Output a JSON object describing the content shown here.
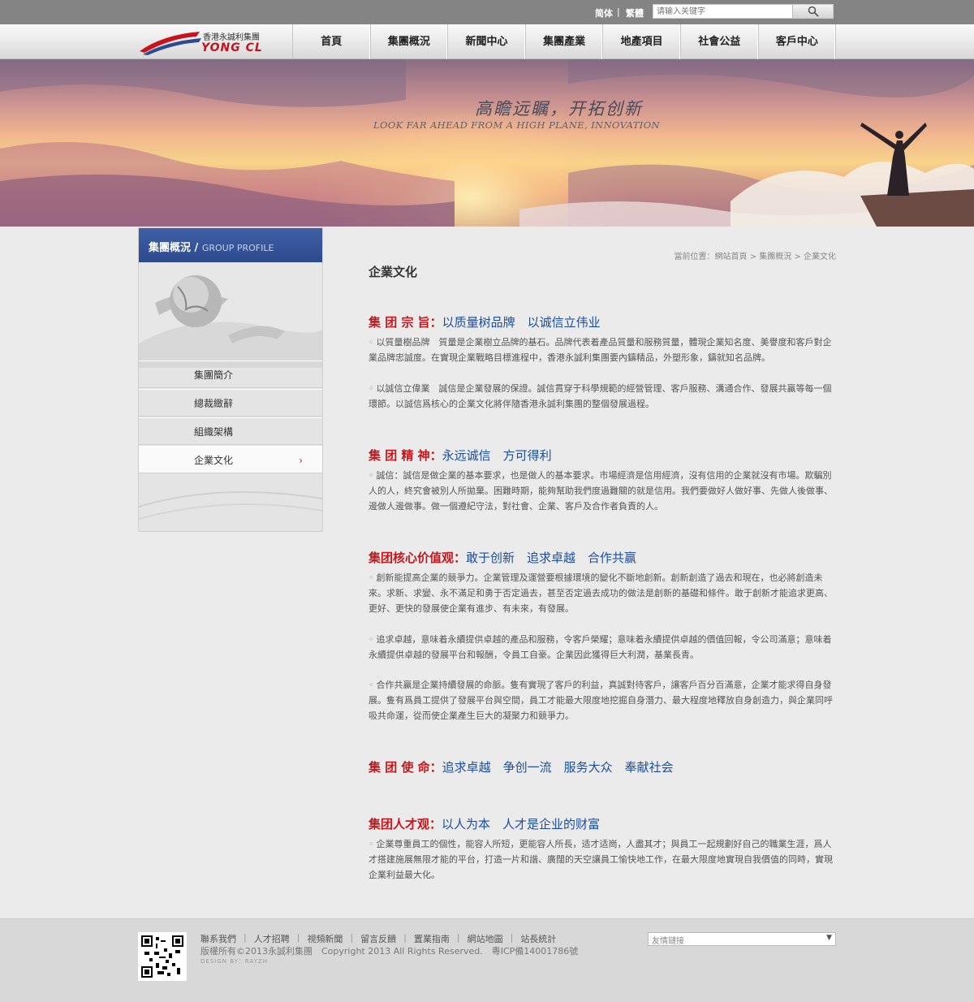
{
  "topbar": {
    "lang_simplified": "简体",
    "lang_separator": "|",
    "lang_traditional": "繁體",
    "search_placeholder": "请输入关键字"
  },
  "logo": {
    "name_cn": "香港永誠利集團",
    "name_en": "YONG CL"
  },
  "nav": {
    "items": [
      "首頁",
      "集團概況",
      "新聞中心",
      "集團產業",
      "地產項目",
      "社會公益",
      "客戶中心"
    ]
  },
  "banner": {
    "slogan": "高瞻远瞩，开拓创新",
    "slogan_en": "LOOK FAR AHEAD FROM A HIGH PLANE, INNOVATION"
  },
  "sidebar": {
    "title": "集團概況 /",
    "title_en": "GROUP PROFILE",
    "items": [
      {
        "label": "集團簡介"
      },
      {
        "label": "總裁緻辭"
      },
      {
        "label": "組織架構"
      },
      {
        "label": "企業文化",
        "active": true
      }
    ],
    "active_arrow": "›"
  },
  "breadcrumb": "當前位置：網站首頁 > 集團概況 > 企業文化",
  "page_title": "企業文化",
  "sections": [
    {
      "key": "集 团 宗 旨：",
      "value": "以质量树品牌　以诚信立伟业",
      "paragraphs": [
        "以質量樹品牌　質量是企業樹立品牌的基石。品牌代表着產品質量和服務質量，體現企業知名度、美譽度和客戶對企業品牌忠誠度。在實現企業戰略目標進程中，香港永誠利集團要內鑄精品，外塑形象，鑄就知名品牌。",
        "以誠信立偉業　誠信是企業發展的保證。誠信貫穿于科學規範的經營管理、客戶服務、溝通合作、發展共贏等每一個環節。以誠信爲核心的企業文化將伴隨香港永誠利集團的整個發展過程。"
      ]
    },
    {
      "key": "集 团 精 神：",
      "value": "永远诚信　方可得利",
      "paragraphs": [
        "誠信：誠信是做企業的基本要求，也是做人的基本要求。市場經濟是信用經濟，沒有信用的企業就沒有市場。欺騙別人的人，終究會被別人所拋棄。困難時期，能夠幫助我們度過難關的就是信用。我們要做好人做好事、先做人後做事、邊做人邊做事。做一個遵紀守法，對社會、企業、客戶及合作者負責的人。"
      ]
    },
    {
      "key": "集团核心价值观：",
      "value": "敢于创新　追求卓越　合作共赢",
      "paragraphs": [
        "創新能提高企業的競爭力。企業管理及運營要根據環境的變化不斷地創新。創新創造了過去和現在，也必將創造未來。求新、求變、永不滿足和勇于否定過去，甚至否定過去成功的做法是創新的基礎和條件。敢于創新才能追求更高、更好、更快的發展使企業有進步、有未來，有發展。",
        "追求卓越，意味着永續提供卓越的產品和服務，令客戶榮耀；意味着永續提供卓越的價值回報，令公司滿意；意味着永續提供卓越的發展平台和報酬，令員工自豪。企業因此獲得巨大利潤，基業長青。",
        "合作共贏是企業持續發展的命脈。隻有實現了客戶的利益，真誠對待客戶，讓客戶百分百滿意，企業才能求得自身發展。隻有爲員工提供了發展平台與空間，員工才能最大限度地挖掘自身潛力、最大程度地釋放自身創造力，與企業同呼吸共命運，從而使企業產生巨大的凝聚力和競爭力。"
      ]
    },
    {
      "key": "集 团 使 命：",
      "value": "追求卓越　争创一流　服务大众　奉献社会",
      "paragraphs": []
    },
    {
      "key": "集团人才观：",
      "value": "以人为本　人才是企业的财富",
      "paragraphs": [
        "企業尊重員工的個性，能容人所短，更能容人所長，适才适崗，人盡其才；與員工一起規劃好自己的職業生涯，爲人才搭建施展無限才能的平台，打造一片和諧、廣闊的天空讓員工愉快地工作，在最大限度地實現自我價值的同時，實現企業利益最大化。"
      ]
    }
  ],
  "footer": {
    "links": [
      "聯系我們",
      "人才招聘",
      "視頻新聞",
      "留言反饋",
      "置業指南",
      "網站地圖",
      "站長統計"
    ],
    "link_separator": "|",
    "copyright": "版權所有©2013永誠利集團　Copyright 2013 All Rights Reserved.　粵ICP備14001786號",
    "design": "DESIGN BY：RAYZH",
    "friend_links_label": "友情鏈接",
    "friend_arrow": "▼"
  },
  "colors": {
    "accent_blue": "#2e4a8e",
    "heading_red": "#c8161d",
    "heading_blue": "#1d4d9c"
  }
}
